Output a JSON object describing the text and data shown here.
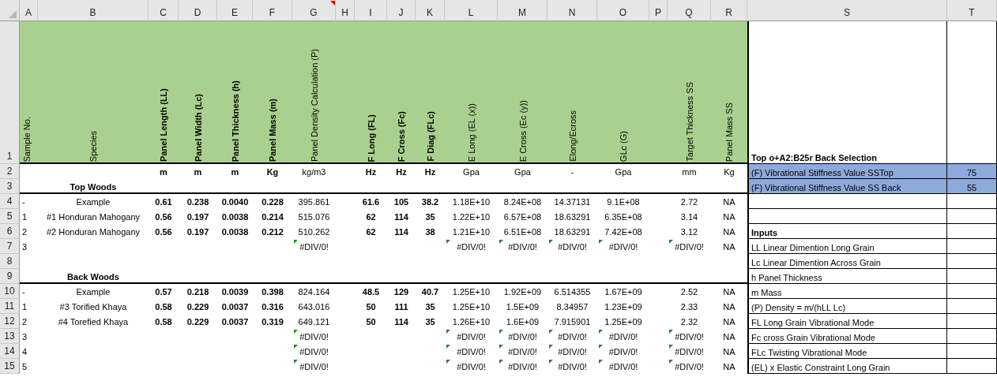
{
  "column_letters": [
    "A",
    "B",
    "C",
    "D",
    "E",
    "F",
    "G",
    "H",
    "I",
    "J",
    "K",
    "L",
    "M",
    "N",
    "O",
    "P",
    "Q",
    "R",
    "S",
    "T"
  ],
  "row_numbers": [
    "1",
    "2",
    "3",
    "4",
    "5",
    "6",
    "7",
    "8",
    "9",
    "10",
    "11",
    "12",
    "13",
    "14",
    "15"
  ],
  "table": {
    "columns": [
      {
        "heading": "Sample No.",
        "bold": false,
        "commented": false
      },
      {
        "heading": "Species",
        "bold": false,
        "commented": false
      },
      {
        "heading": "Panel Length (LL)",
        "unit": "m",
        "bold": true,
        "commented": false
      },
      {
        "heading": "Panel Width (Lc)",
        "unit": "m",
        "bold": true,
        "commented": false
      },
      {
        "heading": "Panel Thickness (h)",
        "unit": "m",
        "bold": true,
        "commented": false
      },
      {
        "heading": "Panel Mass (m)",
        "unit": "Kg",
        "bold": true,
        "commented": false
      },
      {
        "heading": "Panel Density Calculation (P)",
        "unit": "kg/m3",
        "bold": false,
        "commented": true
      },
      null,
      {
        "heading": "F Long (FL)",
        "unit": "Hz",
        "bold": true,
        "commented": false
      },
      {
        "heading": "F Cross (Fc)",
        "unit": "Hz",
        "bold": true,
        "commented": false
      },
      {
        "heading": "F Diag (FLc)",
        "unit": "Hz",
        "bold": true,
        "commented": false
      },
      {
        "heading": "E Long (EL (x))",
        "unit": "Gpa",
        "bold": false,
        "commented": false
      },
      {
        "heading": "E Cross (Ec (y))",
        "unit": "Gpa",
        "bold": false,
        "commented": false
      },
      {
        "heading": "Elong/Ecross",
        "unit": "-",
        "bold": false,
        "commented": false
      },
      {
        "heading": "GLc (G)",
        "unit": "Gpa",
        "bold": false,
        "commented": false
      },
      null,
      {
        "heading": "Target Thickness SS",
        "unit": "mm",
        "bold": false,
        "commented": false
      },
      {
        "heading": "Panel Mass SS",
        "unit": "Kg",
        "bold": false,
        "commented": false
      }
    ],
    "sections": [
      {
        "title": "Top Woods",
        "rows": [
          {
            "cells": [
              {
                "text": "-",
                "error_flag": false
              },
              {
                "text": "Example",
                "error_flag": false
              },
              {
                "text": "0.61",
                "error_flag": false
              },
              {
                "text": "0.238",
                "error_flag": false
              },
              {
                "text": "0.0040",
                "error_flag": false
              },
              {
                "text": "0.228",
                "error_flag": false
              },
              {
                "text": "395.861",
                "error_flag": false
              },
              null,
              {
                "text": "61.6",
                "error_flag": false
              },
              {
                "text": "105",
                "error_flag": false
              },
              {
                "text": "38.2",
                "error_flag": false
              },
              {
                "text": "1.18E+10",
                "error_flag": false
              },
              {
                "text": "8.24E+08",
                "error_flag": false
              },
              {
                "text": "14.37131",
                "error_flag": false
              },
              {
                "text": "9.1E+08",
                "error_flag": false
              },
              null,
              {
                "text": "2.72",
                "error_flag": false
              },
              {
                "text": "NA",
                "error_flag": false
              }
            ]
          },
          {
            "cells": [
              {
                "text": "1",
                "error_flag": false
              },
              {
                "text": "#1 Honduran Mahogany",
                "error_flag": false
              },
              {
                "text": "0.56",
                "error_flag": false
              },
              {
                "text": "0.197",
                "error_flag": false
              },
              {
                "text": "0.0038",
                "error_flag": false
              },
              {
                "text": "0.214",
                "error_flag": false
              },
              {
                "text": "515.076",
                "error_flag": false
              },
              null,
              {
                "text": "62",
                "error_flag": false
              },
              {
                "text": "114",
                "error_flag": false
              },
              {
                "text": "35",
                "error_flag": false
              },
              {
                "text": "1.22E+10",
                "error_flag": false
              },
              {
                "text": "6.57E+08",
                "error_flag": false
              },
              {
                "text": "18.63291",
                "error_flag": false
              },
              {
                "text": "6.35E+08",
                "error_flag": false
              },
              null,
              {
                "text": "3.14",
                "error_flag": false
              },
              {
                "text": "NA",
                "error_flag": false
              }
            ]
          },
          {
            "cells": [
              {
                "text": "2",
                "error_flag": false
              },
              {
                "text": "#2 Honduran Mahogany",
                "error_flag": false
              },
              {
                "text": "0.56",
                "error_flag": false
              },
              {
                "text": "0.197",
                "error_flag": false
              },
              {
                "text": "0.0038",
                "error_flag": false
              },
              {
                "text": "0.212",
                "error_flag": false
              },
              {
                "text": "510.262",
                "error_flag": false
              },
              null,
              {
                "text": "62",
                "error_flag": false
              },
              {
                "text": "114",
                "error_flag": false
              },
              {
                "text": "38",
                "error_flag": false
              },
              {
                "text": "1.21E+10",
                "error_flag": false
              },
              {
                "text": "6.51E+08",
                "error_flag": false
              },
              {
                "text": "18.63291",
                "error_flag": false
              },
              {
                "text": "7.42E+08",
                "error_flag": false
              },
              null,
              {
                "text": "3.12",
                "error_flag": false
              },
              {
                "text": "NA",
                "error_flag": false
              }
            ]
          },
          {
            "cells": [
              {
                "text": "3",
                "error_flag": false
              },
              null,
              null,
              null,
              null,
              null,
              {
                "text": "#DIV/0!",
                "error_flag": true
              },
              null,
              null,
              null,
              null,
              {
                "text": "#DIV/0!",
                "error_flag": true
              },
              {
                "text": "#DIV/0!",
                "error_flag": true
              },
              {
                "text": "#DIV/0!",
                "error_flag": true
              },
              {
                "text": "#DIV/0!",
                "error_flag": true
              },
              null,
              {
                "text": "#DIV/0!",
                "error_flag": true
              },
              {
                "text": "NA",
                "error_flag": false
              }
            ]
          }
        ]
      },
      {
        "title": "Back Woods",
        "rows": [
          {
            "cells": [
              {
                "text": "-",
                "error_flag": false
              },
              {
                "text": "Example",
                "error_flag": false
              },
              {
                "text": "0.57",
                "error_flag": false
              },
              {
                "text": "0.218",
                "error_flag": false
              },
              {
                "text": "0.0039",
                "error_flag": false
              },
              {
                "text": "0.398",
                "error_flag": false
              },
              {
                "text": "824.164",
                "error_flag": false
              },
              null,
              {
                "text": "48.5",
                "error_flag": false
              },
              {
                "text": "129",
                "error_flag": false
              },
              {
                "text": "40.7",
                "error_flag": false
              },
              {
                "text": "1.25E+10",
                "error_flag": false
              },
              {
                "text": "1.92E+09",
                "error_flag": false
              },
              {
                "text": "6.514355",
                "error_flag": false
              },
              {
                "text": "1.67E+09",
                "error_flag": false
              },
              null,
              {
                "text": "2.52",
                "error_flag": false
              },
              {
                "text": "NA",
                "error_flag": false
              }
            ]
          },
          {
            "cells": [
              {
                "text": "1",
                "error_flag": false
              },
              {
                "text": "#3 Torified Khaya",
                "error_flag": false
              },
              {
                "text": "0.58",
                "error_flag": false
              },
              {
                "text": "0.229",
                "error_flag": false
              },
              {
                "text": "0.0037",
                "error_flag": false
              },
              {
                "text": "0.316",
                "error_flag": false
              },
              {
                "text": "643.016",
                "error_flag": false
              },
              null,
              {
                "text": "50",
                "error_flag": false
              },
              {
                "text": "111",
                "error_flag": false
              },
              {
                "text": "35",
                "error_flag": false
              },
              {
                "text": "1.25E+10",
                "error_flag": false
              },
              {
                "text": "1.5E+09",
                "error_flag": false
              },
              {
                "text": "8.34957",
                "error_flag": false
              },
              {
                "text": "1.23E+09",
                "error_flag": false
              },
              null,
              {
                "text": "2.33",
                "error_flag": false
              },
              {
                "text": "NA",
                "error_flag": false
              }
            ]
          },
          {
            "cells": [
              {
                "text": "2",
                "error_flag": false
              },
              {
                "text": "#4 Torefied Khaya",
                "error_flag": false
              },
              {
                "text": "0.58",
                "error_flag": false
              },
              {
                "text": "0.229",
                "error_flag": false
              },
              {
                "text": "0.0037",
                "error_flag": false
              },
              {
                "text": "0.319",
                "error_flag": false
              },
              {
                "text": "649.121",
                "error_flag": false
              },
              null,
              {
                "text": "50",
                "error_flag": false
              },
              {
                "text": "114",
                "error_flag": false
              },
              {
                "text": "35",
                "error_flag": false
              },
              {
                "text": "1.26E+10",
                "error_flag": false
              },
              {
                "text": "1.6E+09",
                "error_flag": false
              },
              {
                "text": "7.915901",
                "error_flag": false
              },
              {
                "text": "1.25E+09",
                "error_flag": false
              },
              null,
              {
                "text": "2.32",
                "error_flag": false
              },
              {
                "text": "NA",
                "error_flag": false
              }
            ]
          },
          {
            "cells": [
              {
                "text": "3",
                "error_flag": false
              },
              null,
              null,
              null,
              null,
              null,
              {
                "text": "#DIV/0!",
                "error_flag": true
              },
              null,
              null,
              null,
              null,
              {
                "text": "#DIV/0!",
                "error_flag": true
              },
              {
                "text": "#DIV/0!",
                "error_flag": true
              },
              {
                "text": "#DIV/0!",
                "error_flag": true
              },
              {
                "text": "#DIV/0!",
                "error_flag": true
              },
              null,
              {
                "text": "#DIV/0!",
                "error_flag": true
              },
              {
                "text": "NA",
                "error_flag": false
              }
            ]
          },
          {
            "cells": [
              {
                "text": "4",
                "error_flag": false
              },
              null,
              null,
              null,
              null,
              null,
              {
                "text": "#DIV/0!",
                "error_flag": true
              },
              null,
              null,
              null,
              null,
              {
                "text": "#DIV/0!",
                "error_flag": true
              },
              {
                "text": "#DIV/0!",
                "error_flag": true
              },
              {
                "text": "#DIV/0!",
                "error_flag": true
              },
              {
                "text": "#DIV/0!",
                "error_flag": true
              },
              null,
              {
                "text": "#DIV/0!",
                "error_flag": true
              },
              {
                "text": "NA",
                "error_flag": false
              }
            ]
          },
          {
            "cells": [
              {
                "text": "5",
                "error_flag": false
              },
              null,
              null,
              null,
              null,
              null,
              {
                "text": "#DIV/0!",
                "error_flag": true
              },
              null,
              null,
              null,
              null,
              {
                "text": "#DIV/0!",
                "error_flag": true
              },
              {
                "text": "#DIV/0!",
                "error_flag": true
              },
              {
                "text": "#DIV/0!",
                "error_flag": true
              },
              {
                "text": "#DIV/0!",
                "error_flag": true
              },
              null,
              {
                "text": "#DIV/0!",
                "error_flag": true
              },
              {
                "text": "NA",
                "error_flag": false
              }
            ]
          }
        ]
      }
    ]
  },
  "side_panel": {
    "title": "Top o+A2:B25r Back Selection",
    "settings": [
      {
        "label": "(F) Vibrational Stiffness Value SSTop",
        "value": "75",
        "highlighted": true
      },
      {
        "label": "(F) Vibrational Stiffness Value SS Back",
        "value": "55",
        "highlighted": true
      }
    ],
    "inputs_title": "Inputs",
    "inputs": [
      "LL Linear Dimention Long Grain",
      "Lc Linear Dimention Across Grain",
      "h Panel Thickness",
      "m Mass",
      "(P) Density = m/(hLL Lc)",
      "FL Long Grain Vibrational Mode",
      "Fc cross Grain Vibrational Mode",
      "FLc Twisting Vibrational Mode",
      "(EL) x Elastic  Constraint Long Grain"
    ]
  }
}
